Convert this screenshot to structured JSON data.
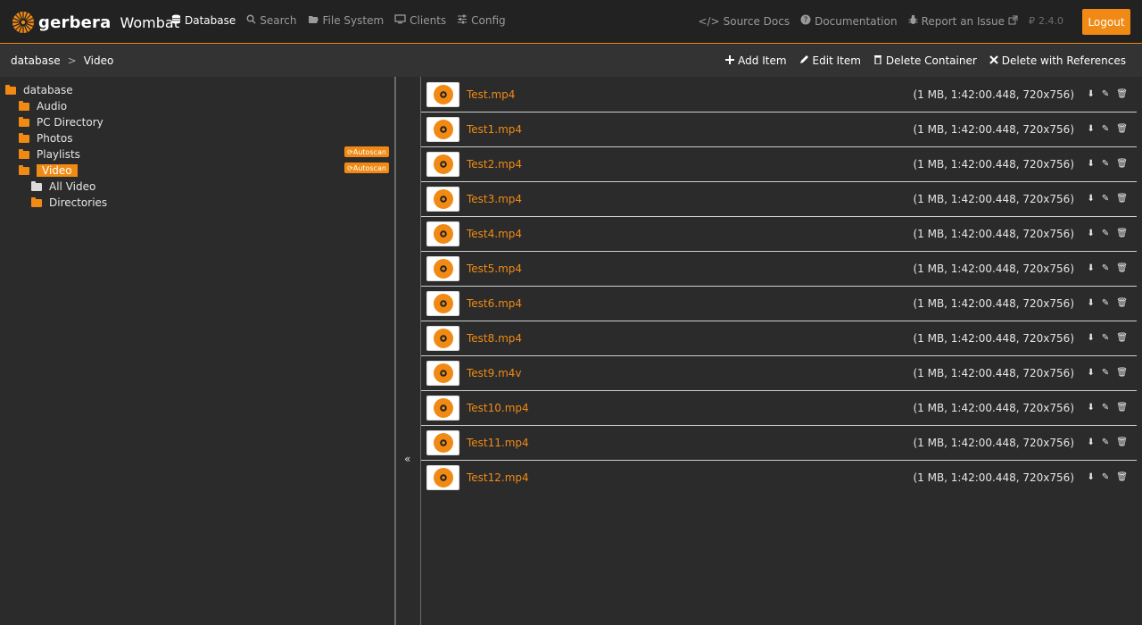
{
  "header": {
    "brand": "gerbera",
    "app_name": "Wombat",
    "nav": [
      {
        "label": "Database",
        "icon": "database-icon",
        "active": true
      },
      {
        "label": "Search",
        "icon": "search-icon"
      },
      {
        "label": "File System",
        "icon": "folder-open-icon"
      },
      {
        "label": "Clients",
        "icon": "monitor-icon"
      },
      {
        "label": "Config",
        "icon": "sliders-icon"
      }
    ],
    "right": [
      {
        "label": "Source Docs",
        "icon": "code-icon"
      },
      {
        "label": "Documentation",
        "icon": "question-icon"
      },
      {
        "label": "Report an Issue",
        "icon": "bug-icon"
      }
    ],
    "version": "2.4.0",
    "logout": "Logout"
  },
  "subbar": {
    "breadcrumb": [
      "database",
      "Video"
    ],
    "actions": [
      "Add Item",
      "Edit Item",
      "Delete Container",
      "Delete with References"
    ]
  },
  "tree": {
    "items": [
      {
        "label": "database",
        "level": 0,
        "open": true
      },
      {
        "label": "Audio",
        "level": 1
      },
      {
        "label": "PC Directory",
        "level": 1
      },
      {
        "label": "Photos",
        "level": 1
      },
      {
        "label": "Playlists",
        "level": 1,
        "badge": "Autoscan"
      },
      {
        "label": "Video",
        "level": 1,
        "open": true,
        "selected": true,
        "badge": "Autoscan"
      },
      {
        "label": "All Video",
        "level": 2,
        "white": true
      },
      {
        "label": "Directories",
        "level": 2
      }
    ]
  },
  "files": [
    {
      "name": "Test.mp4",
      "meta": "(1 MB, 1:42:00.448, 720x756)"
    },
    {
      "name": "Test1.mp4",
      "meta": "(1 MB, 1:42:00.448, 720x756)"
    },
    {
      "name": "Test2.mp4",
      "meta": "(1 MB, 1:42:00.448, 720x756)"
    },
    {
      "name": "Test3.mp4",
      "meta": "(1 MB, 1:42:00.448, 720x756)"
    },
    {
      "name": "Test4.mp4",
      "meta": "(1 MB, 1:42:00.448, 720x756)"
    },
    {
      "name": "Test5.mp4",
      "meta": "(1 MB, 1:42:00.448, 720x756)"
    },
    {
      "name": "Test6.mp4",
      "meta": "(1 MB, 1:42:00.448, 720x756)"
    },
    {
      "name": "Test8.mp4",
      "meta": "(1 MB, 1:42:00.448, 720x756)"
    },
    {
      "name": "Test9.m4v",
      "meta": "(1 MB, 1:42:00.448, 720x756)"
    },
    {
      "name": "Test10.mp4",
      "meta": "(1 MB, 1:42:00.448, 720x756)"
    },
    {
      "name": "Test11.mp4",
      "meta": "(1 MB, 1:42:00.448, 720x756)"
    },
    {
      "name": "Test12.mp4",
      "meta": "(1 MB, 1:42:00.448, 720x756)"
    }
  ],
  "colors": {
    "accent": "#f18a14",
    "bg": "#2b2b2b",
    "topbar": "#222222"
  }
}
